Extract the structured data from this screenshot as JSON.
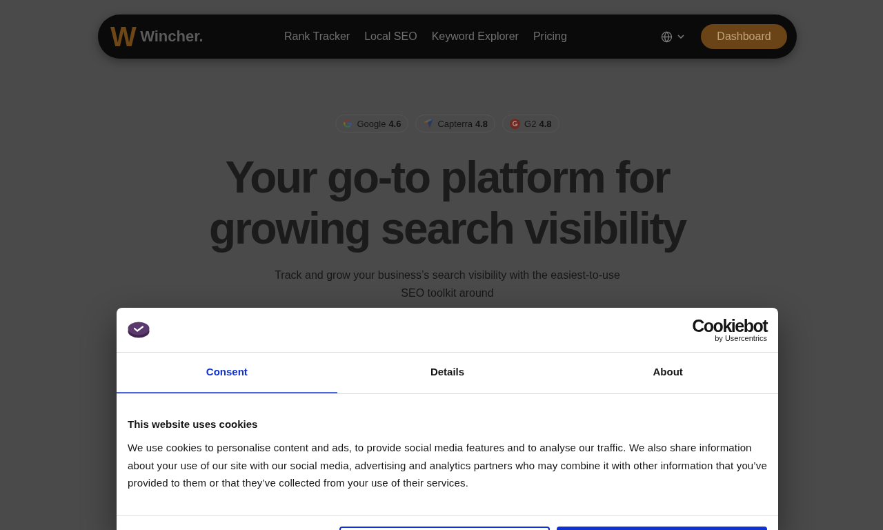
{
  "nav": {
    "logo_mark": "W",
    "logo_name": "Wincher.",
    "links": [
      "Rank Tracker",
      "Local SEO",
      "Keyword Explorer",
      "Pricing"
    ],
    "cta": "Dashboard"
  },
  "hero": {
    "ratings": [
      {
        "kind": "google",
        "name": "Google",
        "score": "4.6"
      },
      {
        "kind": "capterra",
        "name": "Capterra",
        "score": "4.8"
      },
      {
        "kind": "g2",
        "name": "G2",
        "score": "4.8"
      }
    ],
    "headline": "Your go-to platform for growing search visibility",
    "subtitle": "Track and grow your business’s search visibility with the easiest-to-use SEO toolkit around"
  },
  "cookie_dialog": {
    "brand": {
      "name": "Cookiebot",
      "byline": "by Usercentrics"
    },
    "tabs": [
      {
        "label": "Consent",
        "selected": true
      },
      {
        "label": "Details",
        "selected": false
      },
      {
        "label": "About",
        "selected": false
      }
    ],
    "title": "This website uses cookies",
    "body": "We use cookies to personalise content and ads, to provide social media features and to analyse our traffic. We also share information about your use of our site with our social media, advertising and analytics partners who may combine it with other information that you’ve provided to them or that they’ve collected from your use of their services.",
    "buttons": [
      {
        "kind": "outline"
      },
      {
        "kind": "filled"
      }
    ]
  }
}
